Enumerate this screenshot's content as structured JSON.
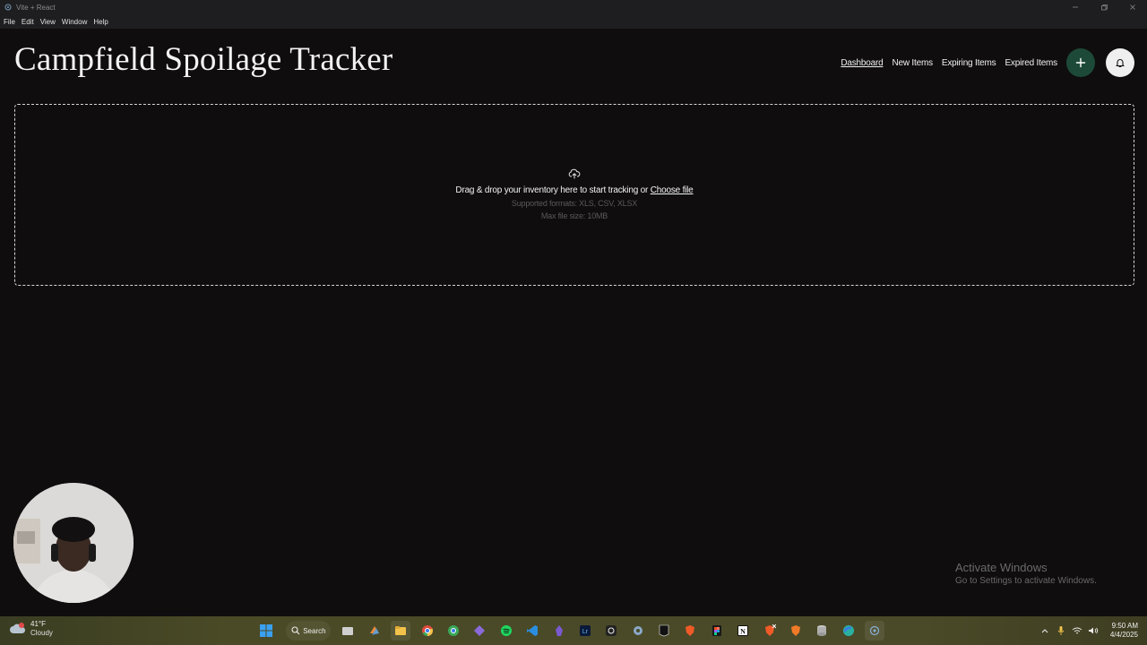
{
  "window": {
    "title": "Vite + React"
  },
  "menu": [
    "File",
    "Edit",
    "View",
    "Window",
    "Help"
  ],
  "header": {
    "title": "Campfield Spoilage Tracker",
    "nav": [
      "Dashboard",
      "New Items",
      "Expiring Items",
      "Expired Items"
    ],
    "add_icon": "plus-icon",
    "notify_icon": "bell-icon"
  },
  "dropzone": {
    "prompt": "Drag & drop your inventory here to start tracking or",
    "link": "Choose file",
    "formats": "Supported formats: XLS, CSV, XLSX",
    "max_size": "Max file size: 10MB",
    "icon": "cloud-upload-icon"
  },
  "watermark": {
    "line1": "Activate Windows",
    "line2": "Go to Settings to activate Windows."
  },
  "taskbar": {
    "weather_temp": "41°F",
    "weather_cond": "Cloudy",
    "search_label": "Search",
    "time": "9:50 AM",
    "date": "4/4/2025"
  },
  "colors": {
    "background": "#0f0d0e",
    "accent": "#1d4a38",
    "taskbar": "#4a4a28"
  }
}
